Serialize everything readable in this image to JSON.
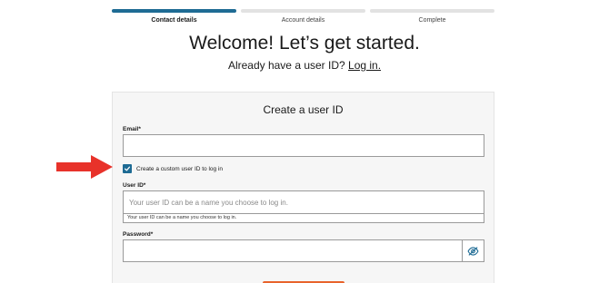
{
  "stepper": {
    "steps": [
      {
        "label": "Contact details",
        "state": "active"
      },
      {
        "label": "Account details",
        "state": "inactive"
      },
      {
        "label": "Complete",
        "state": "inactive"
      }
    ]
  },
  "header": {
    "title": "Welcome! Let’s get started.",
    "subtitle_prefix": "Already have a user ID? ",
    "login_link": "Log in."
  },
  "form": {
    "title": "Create a user ID",
    "email": {
      "label": "Email*",
      "value": "",
      "placeholder": ""
    },
    "custom_id_checkbox": {
      "label": "Create a custom user ID to log in",
      "checked": true
    },
    "user_id": {
      "label": "User ID*",
      "placeholder": "Your user ID can be a name you choose to log in.",
      "hint": "Your user ID can be a name you choose to log in."
    },
    "password": {
      "label": "Password*",
      "value": ""
    }
  },
  "colors": {
    "accent": "#1e6b94",
    "annotation_arrow": "#e8322a",
    "primary_button": "#e8642c"
  },
  "icons": {
    "password_toggle": "eye-slash-icon",
    "checkbox": "checkmark-icon",
    "annotation": "red-arrow-icon"
  }
}
